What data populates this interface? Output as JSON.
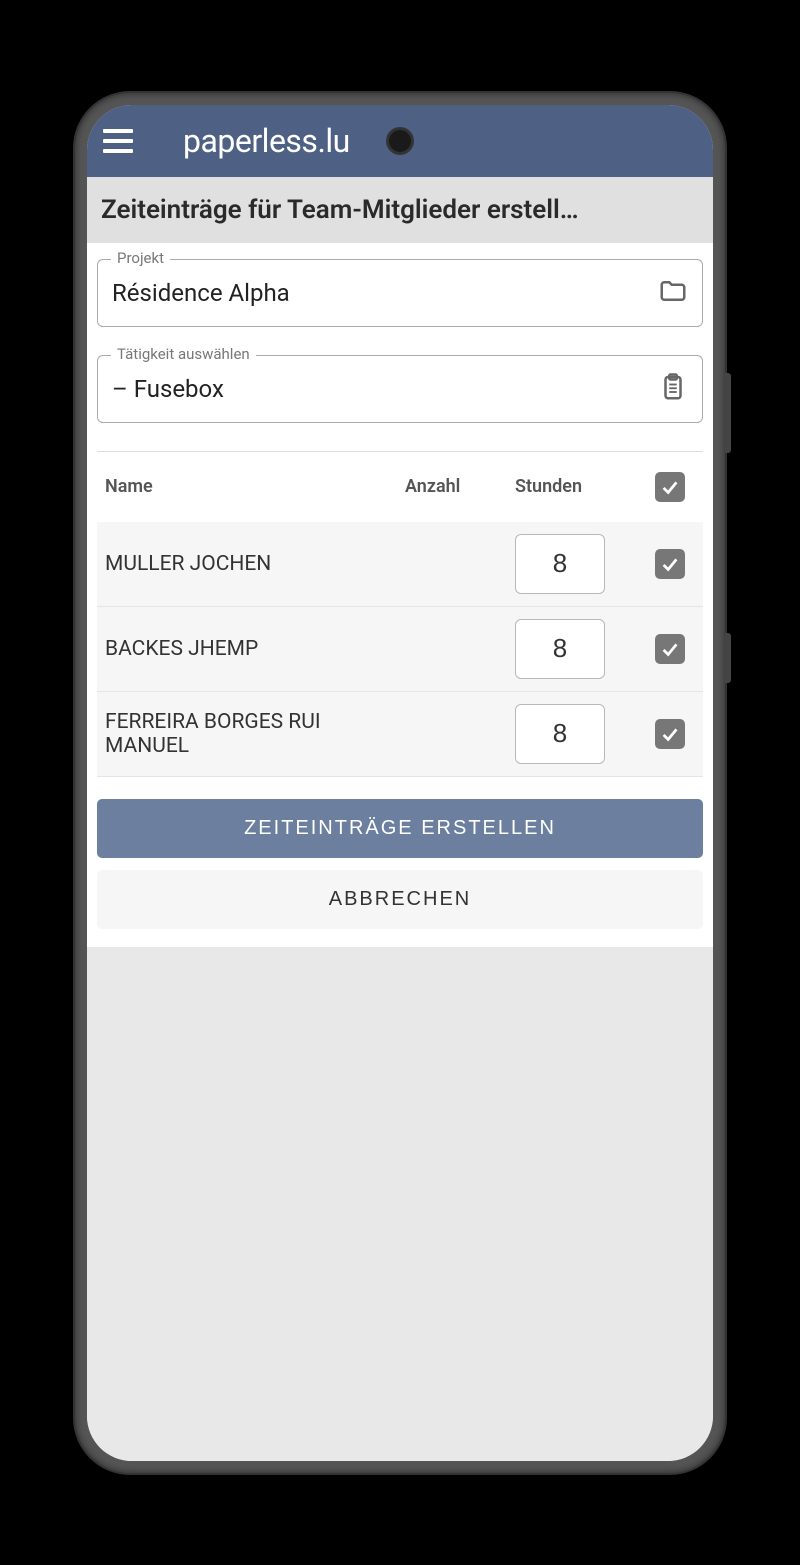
{
  "header": {
    "app_title": "paperless.lu"
  },
  "page": {
    "title": "Zeiteinträge für Team-Mitglieder erstell…"
  },
  "fields": {
    "project": {
      "label": "Projekt",
      "value": "Résidence Alpha"
    },
    "activity": {
      "label": "Tätigkeit auswählen",
      "value": "– Fusebox"
    }
  },
  "table": {
    "headers": {
      "name": "Name",
      "anzahl": "Anzahl",
      "stunden": "Stunden"
    },
    "rows": [
      {
        "name": "MULLER JOCHEN",
        "hours": "8",
        "checked": true
      },
      {
        "name": "BACKES JHEMP",
        "hours": "8",
        "checked": true
      },
      {
        "name": "FERREIRA BORGES RUI MANUEL",
        "hours": "8",
        "checked": true
      }
    ]
  },
  "buttons": {
    "create": "ZEITEINTRÄGE ERSTELLEN",
    "cancel": "ABBRECHEN"
  }
}
